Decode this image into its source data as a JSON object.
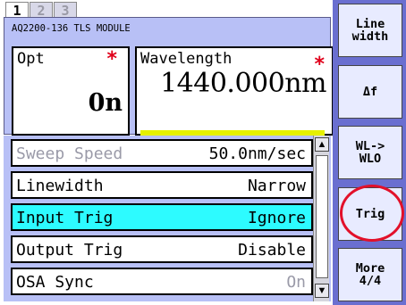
{
  "tabs": [
    {
      "label": "1",
      "active": true
    },
    {
      "label": "2",
      "active": false
    },
    {
      "label": "3",
      "active": false
    }
  ],
  "module_title": "AQ2200-136 TLS MODULE",
  "opt": {
    "label": "Opt",
    "star": "*",
    "value": "0n"
  },
  "wavelength": {
    "label": "Wavelength",
    "star": "*",
    "value": "1440.000nm"
  },
  "menu": [
    {
      "name": "Sweep Speed",
      "value": "50.0nm/sec",
      "state": "disabled"
    },
    {
      "name": "Linewidth",
      "value": "Narrow",
      "state": "normal"
    },
    {
      "name": "Input Trig",
      "value": "Ignore",
      "state": "selected"
    },
    {
      "name": "Output Trig",
      "value": "Disable",
      "state": "normal"
    },
    {
      "name": "OSA Sync",
      "value": "On",
      "state": "value-dim"
    }
  ],
  "scroll": {
    "up": "▲",
    "down": "▼"
  },
  "softkeys": [
    "Line\nwidth",
    "Δf",
    "WL->\nWLO",
    "Trig",
    "More\n4/4"
  ],
  "colors": {
    "panel_bg": "#b8c0f6",
    "selected_row": "#2dfbff",
    "softkey_column": "#6a6fd0",
    "highlight_circle": "#e2102a",
    "star": "#e0001a",
    "wavelength_bar": "#e6f000"
  }
}
